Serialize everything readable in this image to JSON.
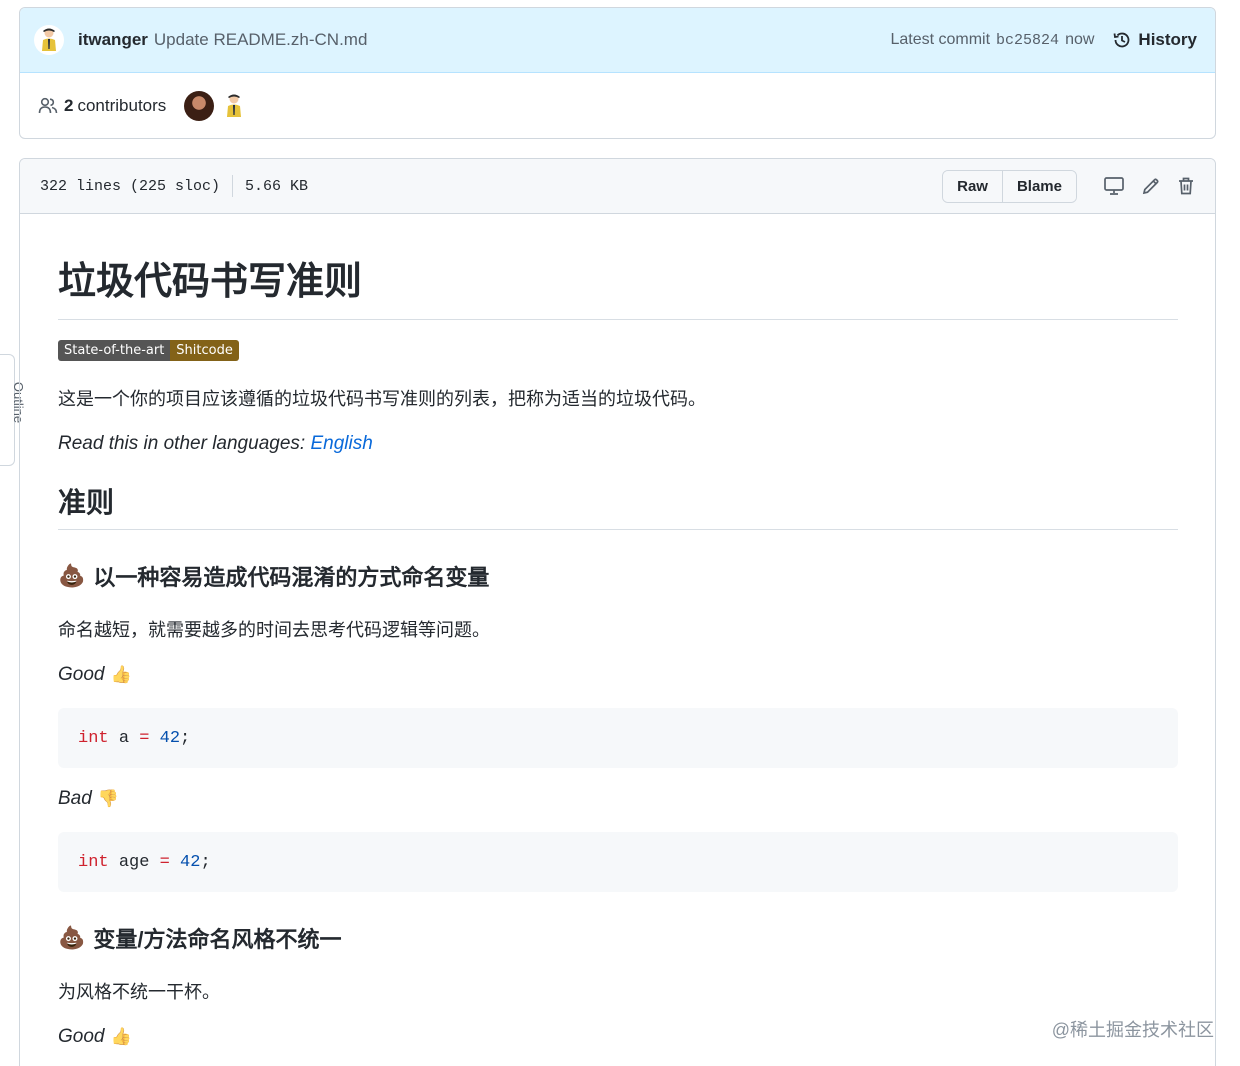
{
  "commit": {
    "author": "itwanger",
    "message": "Update README.zh-CN.md",
    "latest_label": "Latest commit",
    "sha": "bc25824",
    "time": "now",
    "history_label": "History",
    "contributors_count": "2",
    "contributors_label": "contributors"
  },
  "file": {
    "lines": "322 lines (225 sloc)",
    "size": "5.66 KB",
    "raw_label": "Raw",
    "blame_label": "Blame"
  },
  "side_tab": {
    "label": "Outline"
  },
  "readme": {
    "title": "垃圾代码书写准则",
    "badge_left": "State-of-the-art",
    "badge_right": "Shitcode",
    "intro": "这是一个你的项目应该遵循的垃圾代码书写准则的列表，把称为适当的垃圾代码。",
    "languages_prefix": "Read this in other languages: ",
    "languages_link": "English",
    "section_title": "准则",
    "rule1_title": "以一种容易造成代码混淆的方式命名变量",
    "rule1_desc": "命名越短，就需要越多的时间去思考代码逻辑等问题。",
    "good_label": "Good",
    "bad_label": "Bad",
    "code_good": {
      "keyword": "int",
      "name": "a",
      "op": "=",
      "value": "42",
      "end": ";"
    },
    "code_bad": {
      "keyword": "int",
      "name": "age",
      "op": "=",
      "value": "42",
      "end": ";"
    },
    "rule2_title": "变量/方法命名风格不统一",
    "rule2_desc": "为风格不统一干杯。",
    "good_label_2": "Good"
  },
  "watermark": "@稀土掘金技术社区",
  "icons": [
    "person-avatar-icon",
    "people-icon",
    "history-icon",
    "desktop-icon",
    "pencil-icon",
    "trash-icon",
    "poop-emoji-icon",
    "thumbs-up-icon",
    "thumbs-down-icon"
  ]
}
